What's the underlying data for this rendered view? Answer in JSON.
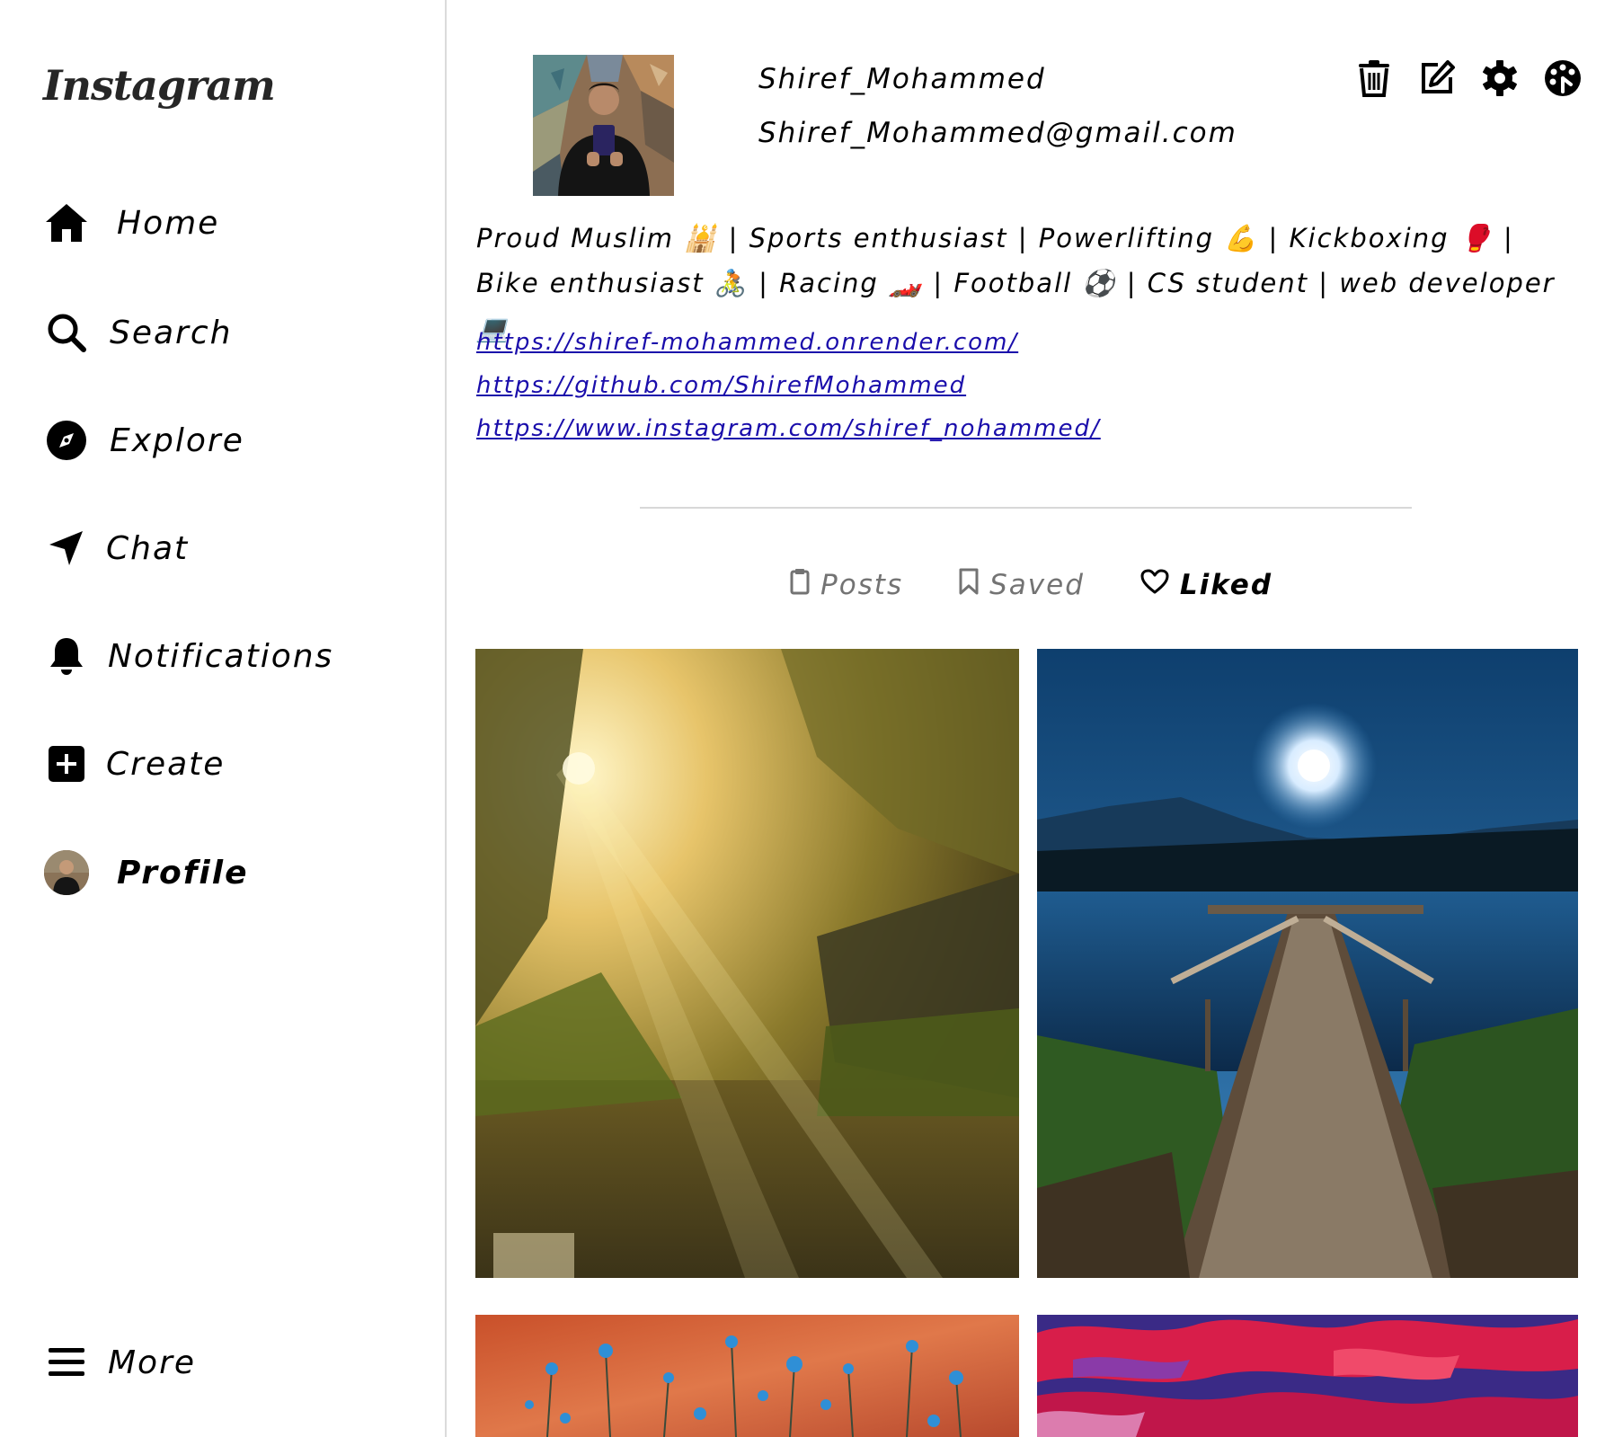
{
  "app": {
    "logo_text": "Instagram"
  },
  "sidebar": {
    "items": [
      {
        "label": "Home",
        "icon": "home-icon"
      },
      {
        "label": "Search",
        "icon": "search-icon"
      },
      {
        "label": "Explore",
        "icon": "compass-icon"
      },
      {
        "label": "Chat",
        "icon": "send-icon"
      },
      {
        "label": "Notifications",
        "icon": "bell-icon"
      },
      {
        "label": "Create",
        "icon": "plus-square-icon"
      },
      {
        "label": "Profile",
        "icon": "avatar",
        "active": true
      }
    ],
    "more": {
      "label": "More",
      "icon": "menu-icon"
    }
  },
  "profile": {
    "username": "Shiref_Mohammed",
    "email": "Shiref_Mohammed@gmail.com",
    "bio": "Proud Muslim 🕌 | Sports enthusiast | Powerlifting 💪 | Kickboxing 🥊 | Bike enthusiast 🚴 | Racing 🏎️ | Football ⚽ | CS student | web developer💻",
    "links": [
      "https://shiref-mohammed.onrender.com/",
      "https://github.com/ShirefMohammed",
      "https://www.instagram.com/shiref_nohammed/"
    ],
    "actions": [
      "trash-icon",
      "edit-icon",
      "gear-icon",
      "palette-icon"
    ]
  },
  "tabs": [
    {
      "label": "Posts",
      "icon": "clipboard-icon",
      "active": false
    },
    {
      "label": "Saved",
      "icon": "bookmark-icon",
      "active": false
    },
    {
      "label": "Liked",
      "icon": "heart-icon",
      "active": true
    }
  ],
  "grid": {
    "images": [
      "sunlit-forest-garden",
      "moonlit-lake-dock",
      "blue-wildflowers-orange",
      "red-purple-clouds"
    ]
  },
  "colors": {
    "link": "#1a0dab",
    "divider": "#d8d8d8",
    "inactive_tab": "#737373",
    "sidebar_border": "#dbdbdb"
  }
}
